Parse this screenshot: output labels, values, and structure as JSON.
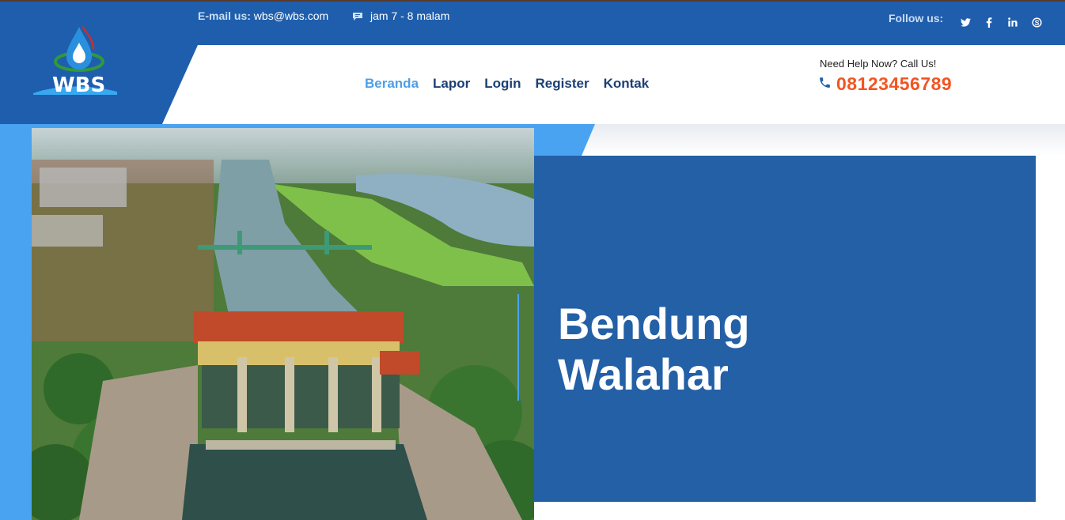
{
  "topbar": {
    "email_label": "E-mail us:",
    "email_value": "wbs@wbs.com",
    "hours": "jam 7 - 8 malam",
    "follow_label": "Follow us:",
    "socials": [
      "twitter-icon",
      "facebook-icon",
      "linkedin-icon",
      "skype-icon"
    ]
  },
  "brand": {
    "logo_text": "WBS"
  },
  "nav": {
    "items": [
      {
        "label": "Beranda",
        "active": true
      },
      {
        "label": "Lapor",
        "active": false
      },
      {
        "label": "Login",
        "active": false
      },
      {
        "label": "Register",
        "active": false
      },
      {
        "label": "Kontak",
        "active": false
      }
    ]
  },
  "help": {
    "prompt": "Need Help Now? Call Us!",
    "phone": "08123456789"
  },
  "hero": {
    "title_line1": "Bendung",
    "title_line2": "Walahar"
  },
  "colors": {
    "primary": "#1f5eac",
    "panel": "#2360a6",
    "accent_light": "#4aa3f0",
    "nav_active": "#4d9fe8",
    "nav_text": "#1b3f74",
    "phone": "#f25522"
  }
}
